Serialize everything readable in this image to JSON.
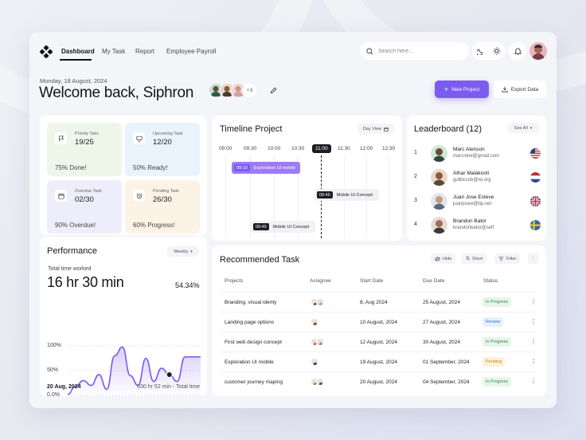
{
  "nav": {
    "links": [
      "Dashboard",
      "My Task",
      "Report",
      "Employee Payroll"
    ],
    "search_placeholder": "Search here..."
  },
  "header": {
    "date": "Monday, 18 August, 2024",
    "welcome": "Welcome back, Siphron",
    "team_more": "+3",
    "new_project": "New Project",
    "export": "Export Data"
  },
  "stats": [
    {
      "label": "Priority Taks",
      "value": "19/25",
      "sub": "75% Done!",
      "bg": "#eef6ea",
      "icon": "flag-icon"
    },
    {
      "label": "Upcoming Task",
      "value": "12/20",
      "sub": "50% Ready!",
      "bg": "#e9f3fb",
      "icon": "monitor-icon"
    },
    {
      "label": "Overdue Task",
      "value": "02/30",
      "sub": "90% Overdue!",
      "bg": "#eeedfb",
      "icon": "calendar-icon"
    },
    {
      "label": "Pending Task",
      "value": "26/30",
      "sub": "60% Progress!",
      "bg": "#fcf2e6",
      "icon": "alarm-icon"
    }
  ],
  "performance": {
    "title": "Performance",
    "period": "Weekly",
    "label": "Total time worked",
    "total": "16 hr 30 min",
    "percent": "54.34%",
    "yticks": [
      "100%",
      "50%",
      "0.0%"
    ],
    "date": "20 Aug, 2024",
    "footer": "630 hr 52 min - Total time"
  },
  "chart_data": {
    "type": "area",
    "title": "Performance",
    "ylim": [
      0,
      100
    ],
    "yticks": [
      "100%",
      "50%",
      "0.0%"
    ],
    "series": [
      {
        "values": [
          2,
          18,
          30,
          20,
          42,
          12,
          80,
          98,
          40,
          20,
          75,
          28,
          55,
          42,
          28,
          78,
          78,
          78
        ]
      }
    ],
    "marker_index": 13
  },
  "timeline": {
    "title": "Timeline Project",
    "view": "Day View",
    "times": [
      "09:00",
      "09:30",
      "10:00",
      "10:30",
      "11:00",
      "11:30",
      "12:00",
      "12:30"
    ],
    "now": "11:00",
    "bars": [
      {
        "time": "09:10",
        "label": "Exploration UI mobile"
      },
      {
        "time": "09:45",
        "label": "Mobile UI Concept"
      },
      {
        "time": "09:45",
        "label": "Mobile UI Concept"
      }
    ]
  },
  "leaderboard": {
    "title": "Leaderboard (12)",
    "see_all": "See All",
    "rows": [
      {
        "rank": "1",
        "name": "Marc Atenson",
        "email": "marcnine@gmail.com",
        "flag": "us-flag-icon",
        "skin": "#6b4a33"
      },
      {
        "rank": "2",
        "name": "Athar Malakooti",
        "email": "gulbicsob@wi.org",
        "flag": "nl-flag-icon",
        "skin": "#8a5a3c"
      },
      {
        "rank": "3",
        "name": "Juan Jose Esteve",
        "email": "juanjosee@tip.net",
        "flag": "uk-flag-icon",
        "skin": "#c89a78"
      },
      {
        "rank": "4",
        "name": "Brandon Bator",
        "email": "brandonbator@self",
        "flag": "se-flag-icon",
        "skin": "#a06e50"
      }
    ]
  },
  "recommended": {
    "title": "Recommended Task",
    "hide": "Hide",
    "short": "Short",
    "filter": "Filter",
    "columns": [
      "Projects",
      "Assignee",
      "Start Date",
      "Due Date",
      "Status"
    ],
    "rows": [
      {
        "project": "Branding, visual identy",
        "start": "8, Aug 2024",
        "due": "25 August, 2024",
        "status": "In Progress",
        "kind": "inprog",
        "assignees": [
          "#8a5a3c",
          "#c89a78"
        ]
      },
      {
        "project": "Landing page options",
        "start": "10 August, 2024",
        "due": "27 August, 2024",
        "status": "Review",
        "kind": "review",
        "assignees": [
          "#6b4a33"
        ]
      },
      {
        "project": "First web design concept",
        "start": "12 August, 2024",
        "due": "30 August, 2024",
        "status": "In Progress",
        "kind": "inprog",
        "assignees": [
          "#d06a4a",
          "#8a8fa0"
        ]
      },
      {
        "project": "Exploration UI mobile",
        "start": "19 August, 2024",
        "due": "01 September, 2024",
        "status": "Pending",
        "kind": "pending",
        "assignees": [
          "#3a3a3a"
        ]
      },
      {
        "project": "customer journey maping",
        "start": "20 August, 2024",
        "due": "04 September, 2024",
        "status": "In Progress",
        "kind": "inprog",
        "assignees": [
          "#b07a5a",
          "#6b4a33"
        ]
      }
    ]
  },
  "colors": {
    "accent": "#7b5cf0",
    "dark": "#1c1d24"
  }
}
